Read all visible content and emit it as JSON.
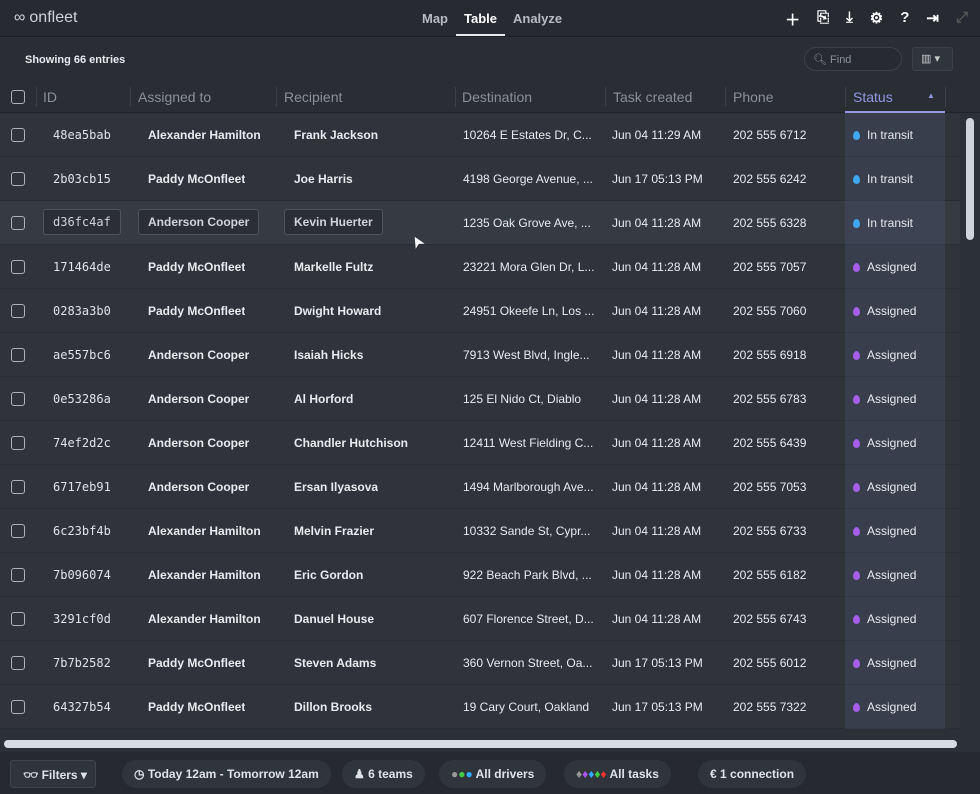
{
  "app": {
    "brand": "onfleet"
  },
  "nav": {
    "tabs": [
      {
        "label": "Map"
      },
      {
        "label": "Table",
        "active": true
      },
      {
        "label": "Analyze"
      }
    ]
  },
  "toolbar": {
    "icons": [
      "plus-icon",
      "import-icon",
      "download-icon",
      "gear-icon",
      "help-icon",
      "logout-icon",
      "expand-icon"
    ]
  },
  "summary": {
    "text": "Showing 66 entries"
  },
  "search": {
    "placeholder": "Find"
  },
  "columns": [
    "ID",
    "Assigned to",
    "Recipient",
    "Destination",
    "Task created",
    "Phone",
    "Status"
  ],
  "colors": {
    "in_transit": "#3fa7f0",
    "assigned": "#a45ee8",
    "accent": "#8f98e0"
  },
  "rows": [
    {
      "id": "48ea5bab",
      "assigned": "Alexander Hamilton",
      "recipient": "Frank Jackson",
      "destination": "10264 E Estates Dr, C...",
      "created": "Jun 04 11:29 AM",
      "phone": "202 555 6712",
      "status": "In transit"
    },
    {
      "id": "2b03cb15",
      "assigned": "Paddy McOnfleet",
      "recipient": "Joe Harris",
      "destination": "4198 George Avenue, ...",
      "created": "Jun 17 05:13 PM",
      "phone": "202 555 6242",
      "status": "In transit"
    },
    {
      "id": "d36fc4af",
      "assigned": "Anderson Cooper",
      "recipient": "Kevin Huerter",
      "destination": "1235 Oak Grove Ave, ...",
      "created": "Jun 04 11:28 AM",
      "phone": "202 555 6328",
      "status": "In transit",
      "hover": true
    },
    {
      "id": "171464de",
      "assigned": "Paddy McOnfleet",
      "recipient": "Markelle Fultz",
      "destination": "23221 Mora Glen Dr, L...",
      "created": "Jun 04 11:28 AM",
      "phone": "202 555 7057",
      "status": "Assigned"
    },
    {
      "id": "0283a3b0",
      "assigned": "Paddy McOnfleet",
      "recipient": "Dwight Howard",
      "destination": "24951 Okeefe Ln, Los ...",
      "created": "Jun 04 11:28 AM",
      "phone": "202 555 7060",
      "status": "Assigned"
    },
    {
      "id": "ae557bc6",
      "assigned": "Anderson Cooper",
      "recipient": "Isaiah Hicks",
      "destination": "7913 West Blvd, Ingle...",
      "created": "Jun 04 11:28 AM",
      "phone": "202 555 6918",
      "status": "Assigned"
    },
    {
      "id": "0e53286a",
      "assigned": "Anderson Cooper",
      "recipient": "Al Horford",
      "destination": "125 El Nido Ct, Diablo",
      "created": "Jun 04 11:28 AM",
      "phone": "202 555 6783",
      "status": "Assigned"
    },
    {
      "id": "74ef2d2c",
      "assigned": "Anderson Cooper",
      "recipient": "Chandler Hutchison",
      "destination": "12411 West Fielding C...",
      "created": "Jun 04 11:28 AM",
      "phone": "202 555 6439",
      "status": "Assigned"
    },
    {
      "id": "6717eb91",
      "assigned": "Anderson Cooper",
      "recipient": "Ersan Ilyasova",
      "destination": "1494 Marlborough Ave...",
      "created": "Jun 04 11:28 AM",
      "phone": "202 555 7053",
      "status": "Assigned"
    },
    {
      "id": "6c23bf4b",
      "assigned": "Alexander Hamilton",
      "recipient": "Melvin Frazier",
      "destination": "10332 Sande St, Cypr...",
      "created": "Jun 04 11:28 AM",
      "phone": "202 555 6733",
      "status": "Assigned"
    },
    {
      "id": "7b096074",
      "assigned": "Alexander Hamilton",
      "recipient": "Eric Gordon",
      "destination": "922 Beach Park Blvd, ...",
      "created": "Jun 04 11:28 AM",
      "phone": "202 555 6182",
      "status": "Assigned"
    },
    {
      "id": "3291cf0d",
      "assigned": "Alexander Hamilton",
      "recipient": "Danuel House",
      "destination": "607 Florence Street, D...",
      "created": "Jun 04 11:28 AM",
      "phone": "202 555 6743",
      "status": "Assigned"
    },
    {
      "id": "7b7b2582",
      "assigned": "Paddy McOnfleet",
      "recipient": "Steven Adams",
      "destination": "360 Vernon Street, Oa...",
      "created": "Jun 17 05:13 PM",
      "phone": "202 555 6012",
      "status": "Assigned"
    },
    {
      "id": "64327b54",
      "assigned": "Paddy McOnfleet",
      "recipient": "Dillon Brooks",
      "destination": "19 Cary Court, Oakland",
      "created": "Jun 17 05:13 PM",
      "phone": "202 555 7322",
      "status": "Assigned"
    }
  ],
  "footer": {
    "filters": "Filters",
    "time_range": "Today 12am - Tomorrow 12am",
    "teams": "6 teams",
    "drivers": "All drivers",
    "tasks": "All tasks",
    "connection": "1 connection"
  }
}
